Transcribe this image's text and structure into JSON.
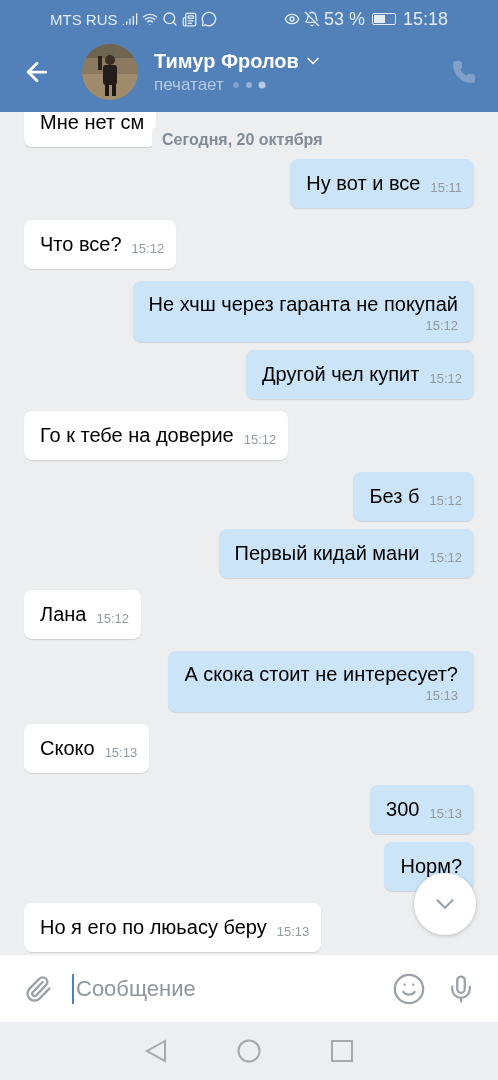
{
  "status_bar": {
    "carrier": "MTS RUS",
    "battery": "53 %",
    "time": "15:18"
  },
  "header": {
    "name": "Тимур Фролов",
    "status": "печатает"
  },
  "date_pill": "Сегодня, 20 октября",
  "messages": [
    {
      "outgoing": false,
      "kind": "inline",
      "text": "Мне нет см"
    },
    {
      "outgoing": true,
      "kind": "inline",
      "text": "Ну вот и все",
      "time": "15:11"
    },
    {
      "outgoing": false,
      "kind": "inline",
      "text": "Что все?",
      "time": "15:12"
    },
    {
      "outgoing": true,
      "kind": "stacked",
      "text": "Не хчш через гаранта не покупай",
      "time": "15:12"
    },
    {
      "outgoing": true,
      "kind": "inline",
      "text": "Другой чел купит",
      "time": "15:12"
    },
    {
      "outgoing": false,
      "kind": "inline",
      "text": "Го к тебе на доверие",
      "time": "15:12"
    },
    {
      "outgoing": true,
      "kind": "inline",
      "text": "Без б",
      "time": "15:12"
    },
    {
      "outgoing": true,
      "kind": "inline",
      "text": "Первый кидай мани",
      "time": "15:12"
    },
    {
      "outgoing": false,
      "kind": "inline",
      "text": "Лана",
      "time": "15:12"
    },
    {
      "outgoing": true,
      "kind": "stacked",
      "text": "А скока стоит не интересует?",
      "time": "15:13"
    },
    {
      "outgoing": false,
      "kind": "inline",
      "text": "Скоко",
      "time": "15:13"
    },
    {
      "outgoing": true,
      "kind": "inline",
      "text": "300",
      "time": "15:13"
    },
    {
      "outgoing": true,
      "kind": "inline",
      "text": "Норм?"
    },
    {
      "outgoing": false,
      "kind": "inline",
      "text": "Но я его по люьасу беру",
      "time": "15:13"
    }
  ],
  "composer": {
    "placeholder": "Сообщение"
  }
}
